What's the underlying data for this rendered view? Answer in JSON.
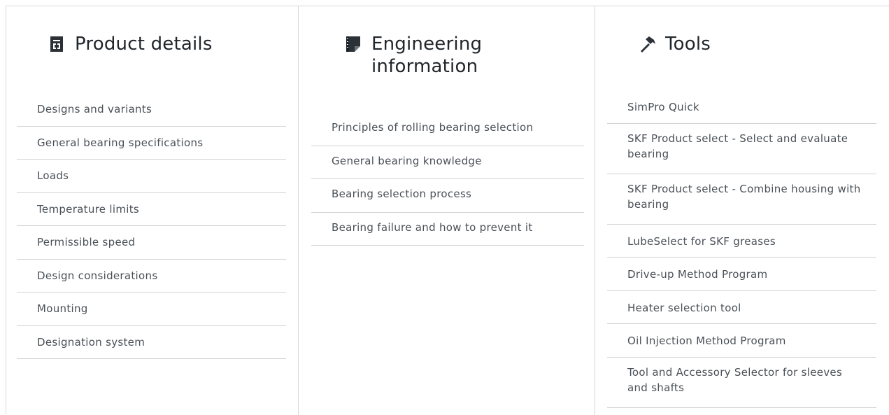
{
  "columns": [
    {
      "heading": "Product details",
      "icon": "document-icon",
      "links": [
        "Designs and variants",
        "General bearing specifications",
        "Loads",
        "Temperature limits",
        "Permissible speed",
        "Design considerations",
        "Mounting",
        "Designation system"
      ]
    },
    {
      "heading": "Engineering information",
      "icon": "notebook-icon",
      "links": [
        "Principles of rolling bearing selection",
        "General bearing knowledge",
        "Bearing selection process",
        "Bearing failure and how to prevent it"
      ]
    },
    {
      "heading": "Tools",
      "icon": "hammer-icon",
      "links": [
        "SimPro Quick",
        "SKF Product select - Select and evaluate bearing",
        "SKF Product select - Combine housing with bearing",
        "LubeSelect for SKF greases",
        "Drive-up Method Program",
        "Heater selection tool",
        "Oil Injection Method Program",
        "Tool and Accessory Selector for sleeves and shafts"
      ]
    }
  ],
  "colors": {
    "heading": "#20262c",
    "link": "#4a5057",
    "divider": "#cfd3d6",
    "icon": "#2b3137"
  }
}
